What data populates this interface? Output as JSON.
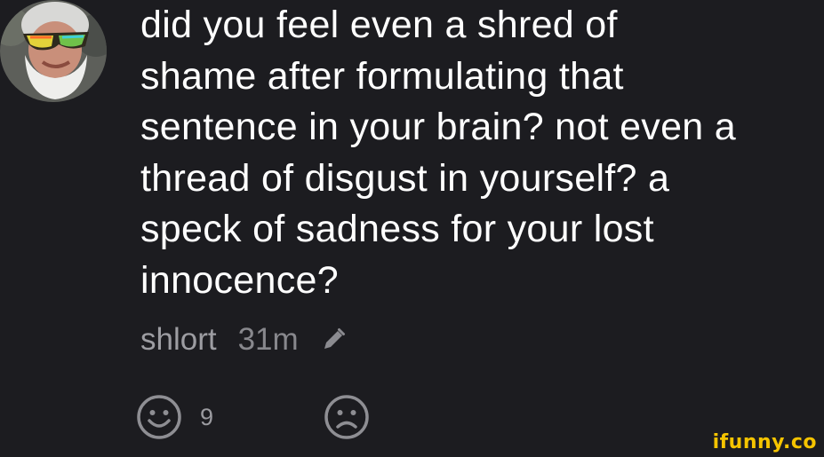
{
  "comment": {
    "text": "did you feel even a shred of\nshame after formulating that\nsentence in your brain? not even a\nthread of disgust in yourself? a\nspeck of sadness for your lost\ninnocence?",
    "author": "shlort",
    "time": "31m"
  },
  "reactions": {
    "smile_count": "9"
  },
  "icons": {
    "edit": "pencil-icon",
    "smile": "smile-face-icon",
    "frown": "frown-face-icon"
  },
  "watermark": "ifunny.co",
  "colors": {
    "background": "#1c1c20",
    "text": "#ffffff",
    "meta": "#8b8b90",
    "watermark": "#f5c400"
  }
}
